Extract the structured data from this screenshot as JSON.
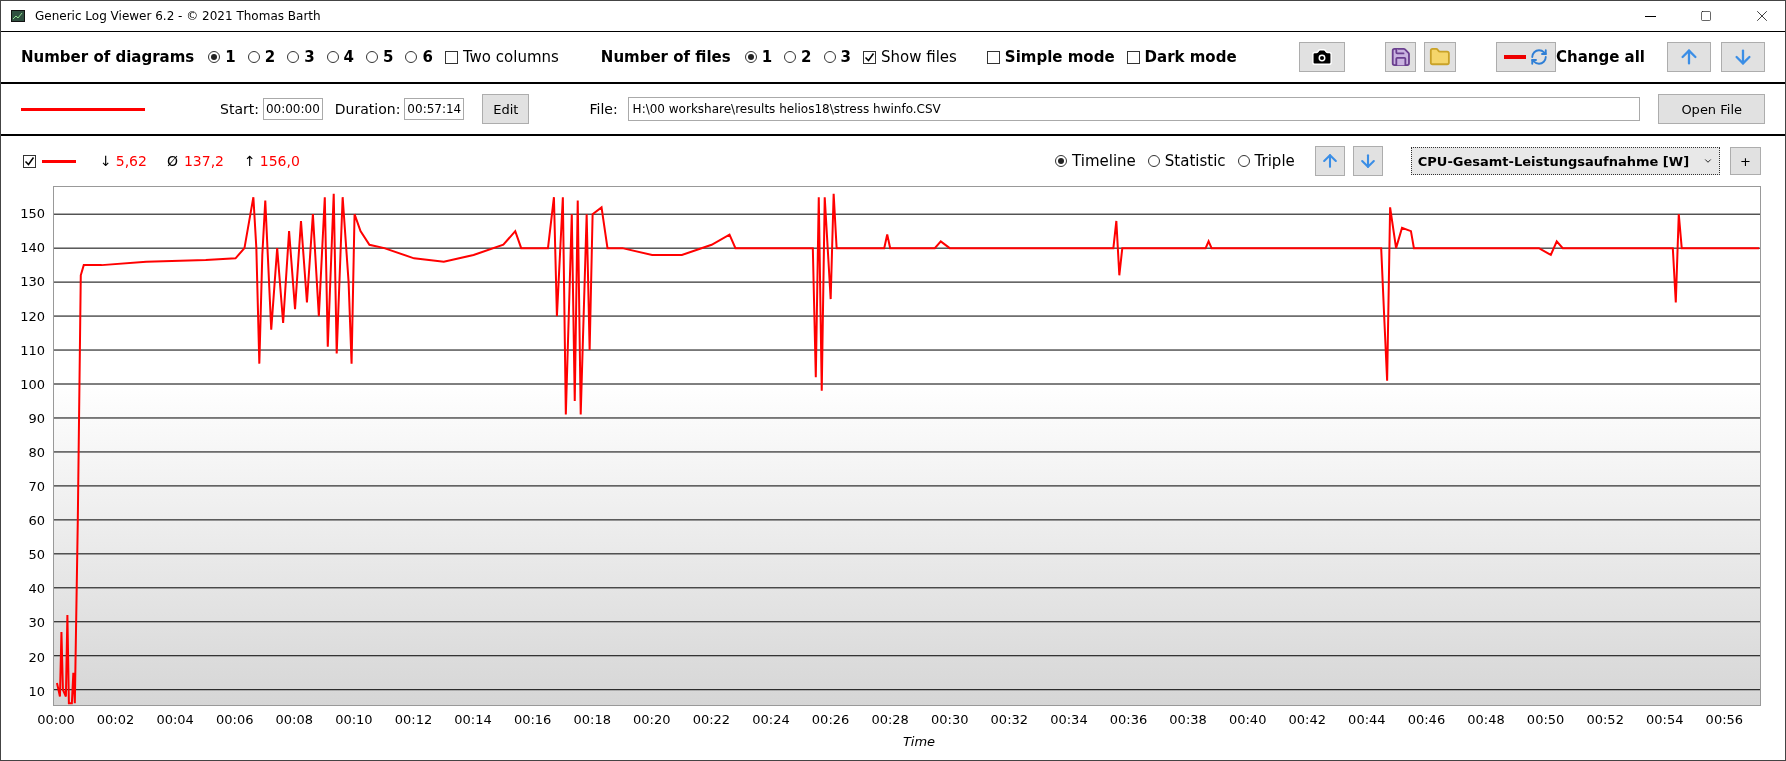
{
  "window": {
    "title": "Generic Log Viewer 6.2 - © 2021 Thomas Barth"
  },
  "toolbar": {
    "diagrams_label": "Number of diagrams",
    "diagram_options": [
      {
        "label": "1",
        "selected": true
      },
      {
        "label": "2",
        "selected": false
      },
      {
        "label": "3",
        "selected": false
      },
      {
        "label": "4",
        "selected": false
      },
      {
        "label": "5",
        "selected": false
      },
      {
        "label": "6",
        "selected": false
      }
    ],
    "two_columns": {
      "label": "Two columns",
      "checked": false
    },
    "files_label": "Number of files",
    "file_options": [
      {
        "label": "1",
        "selected": true
      },
      {
        "label": "2",
        "selected": false
      },
      {
        "label": "3",
        "selected": false
      }
    ],
    "show_files": {
      "label": "Show files",
      "checked": true
    },
    "simple_mode": {
      "label": "Simple mode",
      "checked": false
    },
    "dark_mode": {
      "label": "Dark mode",
      "checked": false
    },
    "change_all_label": "Change all"
  },
  "file_row": {
    "start_label": "Start:",
    "start": "00:00:00",
    "duration_label": "Duration:",
    "duration": "00:57:14",
    "edit_button": "Edit",
    "file_label": "File:",
    "file_path": "H:\\00 workshare\\results helios18\\stress hwinfo.CSV",
    "open_button": "Open File"
  },
  "diagram": {
    "visible": {
      "checked": true
    },
    "min_symbol": "↓",
    "min": "5,62",
    "avg_symbol": "Ø",
    "avg": "137,2",
    "max_symbol": "↑",
    "max": "156,0",
    "views": [
      {
        "label": "Timeline",
        "selected": true
      },
      {
        "label": "Statistic",
        "selected": false
      },
      {
        "label": "Triple",
        "selected": false
      }
    ],
    "add_button": "+",
    "chart_data": {
      "type": "line",
      "xlabel": "Time",
      "grid": true,
      "xlim": [
        -0.1,
        57.23
      ],
      "ylim": [
        5.5,
        158
      ],
      "xticks": [
        {
          "value": 0,
          "label": "00:00"
        },
        {
          "value": 2,
          "label": "00:02"
        },
        {
          "value": 4,
          "label": "00:04"
        },
        {
          "value": 6,
          "label": "00:06"
        },
        {
          "value": 8,
          "label": "00:08"
        },
        {
          "value": 10,
          "label": "00:10"
        },
        {
          "value": 12,
          "label": "00:12"
        },
        {
          "value": 14,
          "label": "00:14"
        },
        {
          "value": 16,
          "label": "00:16"
        },
        {
          "value": 18,
          "label": "00:18"
        },
        {
          "value": 20,
          "label": "00:20"
        },
        {
          "value": 22,
          "label": "00:22"
        },
        {
          "value": 24,
          "label": "00:24"
        },
        {
          "value": 26,
          "label": "00:26"
        },
        {
          "value": 28,
          "label": "00:28"
        },
        {
          "value": 30,
          "label": "00:30"
        },
        {
          "value": 32,
          "label": "00:32"
        },
        {
          "value": 34,
          "label": "00:34"
        },
        {
          "value": 36,
          "label": "00:36"
        },
        {
          "value": 38,
          "label": "00:38"
        },
        {
          "value": 40,
          "label": "00:40"
        },
        {
          "value": 42,
          "label": "00:42"
        },
        {
          "value": 44,
          "label": "00:44"
        },
        {
          "value": 46,
          "label": "00:46"
        },
        {
          "value": 48,
          "label": "00:48"
        },
        {
          "value": 50,
          "label": "00:50"
        },
        {
          "value": 52,
          "label": "00:52"
        },
        {
          "value": 54,
          "label": "00:54"
        },
        {
          "value": 56,
          "label": "00:56"
        }
      ],
      "yticks": [
        10,
        20,
        30,
        40,
        50,
        60,
        70,
        80,
        90,
        100,
        110,
        120,
        130,
        140,
        150
      ],
      "x": [
        0,
        0.1,
        0.15,
        0.2,
        0.3,
        0.35,
        0.4,
        0.5,
        0.55,
        0.6,
        0.7,
        0.8,
        0.9,
        1.5,
        3,
        5,
        6,
        6.3,
        6.5,
        6.6,
        6.7,
        6.8,
        6.9,
        7.0,
        7.2,
        7.4,
        7.6,
        7.8,
        8.0,
        8.2,
        8.4,
        8.6,
        8.8,
        9.0,
        9.1,
        9.3,
        9.4,
        9.6,
        9.8,
        9.9,
        10.0,
        10.2,
        10.5,
        11,
        12,
        13,
        14,
        15,
        15.4,
        15.6,
        16.5,
        16.7,
        16.8,
        17.0,
        17.1,
        17.3,
        17.4,
        17.5,
        17.6,
        17.8,
        17.9,
        18.0,
        18.3,
        18.5,
        19,
        20,
        21,
        22,
        22.6,
        22.8,
        25.4,
        25.5,
        25.6,
        25.7,
        25.8,
        26.0,
        26.1,
        26.2,
        27.8,
        27.9,
        28,
        29.5,
        29.7,
        30,
        35.5,
        35.6,
        35.7,
        35.8,
        38.6,
        38.7,
        38.8,
        44.5,
        44.6,
        44.7,
        44.8,
        45,
        45.2,
        45.5,
        45.6,
        49.8,
        50.2,
        50.4,
        50.6,
        54.3,
        54.4,
        54.5,
        54.6,
        57.2
      ],
      "series": [
        {
          "name": "CPU-Gesamt-Leistungsaufnahme [W]",
          "color": "#ff0000",
          "values": [
            12,
            8,
            27,
            10,
            8,
            32,
            6,
            6,
            15,
            6,
            60,
            132,
            135,
            135,
            136,
            136.5,
            137,
            140,
            150,
            155,
            140,
            106,
            138,
            154,
            116,
            140,
            118,
            145,
            122,
            148,
            124,
            150,
            120,
            155,
            111,
            156,
            109,
            155,
            130,
            106,
            150,
            145,
            141,
            140,
            137,
            136,
            138,
            141,
            145,
            140,
            140,
            155,
            120,
            155,
            91,
            150,
            95,
            154,
            91,
            150,
            110,
            150,
            152,
            140,
            140,
            138,
            138,
            141,
            144,
            140,
            140,
            102,
            155,
            98,
            155,
            125,
            156,
            140,
            140,
            144,
            140,
            140,
            142,
            140,
            140,
            148,
            132,
            140,
            140,
            142,
            140,
            140,
            120,
            101,
            152,
            140,
            146,
            145,
            140,
            140,
            138,
            142,
            140,
            140,
            124,
            150,
            140,
            140
          ]
        }
      ]
    }
  }
}
